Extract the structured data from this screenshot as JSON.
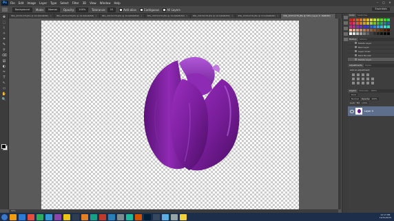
{
  "app": {
    "logo": "Ps"
  },
  "menu": [
    "File",
    "Edit",
    "Image",
    "Layer",
    "Type",
    "Select",
    "Filter",
    "3D",
    "View",
    "Window",
    "Help"
  ],
  "window_controls": [
    "–",
    "▢",
    "✕"
  ],
  "options": {
    "sample": "Background",
    "mode_label": "Mode:",
    "mode_value": "Normal",
    "opacity_label": "Opacity:",
    "opacity_value": "100%",
    "tolerance_label": "Tolerance:",
    "tolerance_value": "10",
    "anti_alias": "Anti-alias",
    "contiguous": "Contiguous",
    "all_layers": "All Layers",
    "workspace": "Essentials"
  },
  "tools": [
    "✥",
    "⬚",
    "⌇",
    "✧",
    "⌗",
    "✎",
    "⚲",
    "⌫",
    "▤",
    "◐",
    "✑",
    "T",
    "↖",
    "▭",
    "✋",
    "🔍"
  ],
  "doc_tabs": [
    {
      "label": "IMG_20151276.JPG @ 19.9(RGB/8#)",
      "active": false
    },
    {
      "label": "IMG_20151276.JPG @ 19.9(RGB/8#)",
      "active": false
    },
    {
      "label": "IMG_20151276.JPG @ 19.9(RGB/8#)",
      "active": false
    },
    {
      "label": "IMG_20151276.JPG @ 19.9(RGB/8#)",
      "active": false
    },
    {
      "label": "IMG_20151276.JPG @ 19.9(RGB/8#)",
      "active": false
    },
    {
      "label": "IMG_20151276.JPG @ 19.9(RGB/8#)",
      "active": false
    },
    {
      "label": "IMG_20151276.JPG @ 50% (Layer 0, RGB/8#)",
      "active": true
    }
  ],
  "status": "50%",
  "swatch_tabs": [
    "Color",
    "Swatches"
  ],
  "swatch_colors": [
    "#e02020",
    "#e03a20",
    "#e05a20",
    "#e07a20",
    "#e09a20",
    "#e0ba20",
    "#e0da20",
    "#c0e020",
    "#90e020",
    "#60e020",
    "#30e020",
    "#20e050",
    "#d02850",
    "#d04060",
    "#d06040",
    "#d08030",
    "#d0a030",
    "#d0c030",
    "#b0d030",
    "#80c030",
    "#50b040",
    "#40a060",
    "#308080",
    "#3060a0",
    "#c03080",
    "#b03090",
    "#9030a0",
    "#7030b0",
    "#5030c0",
    "#3040c0",
    "#3060d0",
    "#3080e0",
    "#30a0e0",
    "#30c0e0",
    "#30e0e0",
    "#30e0b0",
    "#f0c0a0",
    "#e0b090",
    "#d0a080",
    "#c09070",
    "#b08060",
    "#a07050",
    "#906040",
    "#805030",
    "#704020",
    "#603010",
    "#502000",
    "#401000",
    "#ffffff",
    "#e0e0e0",
    "#c0c0c0",
    "#a0a0a0",
    "#808080",
    "#606060",
    "#404040",
    "#303030",
    "#202020",
    "#101010",
    "#080808",
    "#000000"
  ],
  "history_tabs": [
    "History",
    "Actions"
  ],
  "history": [
    {
      "label": "Delete Layer",
      "selected": false
    },
    {
      "label": "New Layer",
      "selected": false
    },
    {
      "label": "Layer Order",
      "selected": false
    },
    {
      "label": "Paint Bucket",
      "selected": false
    },
    {
      "label": "Delete Layer",
      "selected": true
    }
  ],
  "adjust_tabs": [
    "Adjustments",
    "Styles"
  ],
  "adjust_title": "Add an adjustment",
  "layers_tabs": [
    "Layers",
    "Channels",
    "Paths"
  ],
  "layers": {
    "kind": "Kind",
    "blend": "Normal",
    "opacity_label": "Opacity:",
    "opacity": "100%",
    "lock_label": "Lock:",
    "fill_label": "Fill:",
    "fill": "100%",
    "rows": [
      {
        "name": "Layer 0"
      }
    ]
  },
  "taskbar": {
    "apps": [
      "#f39c12",
      "#2b7bd6",
      "#e74c3c",
      "#27ae60",
      "#3498db",
      "#8e44ad",
      "#f1c40f",
      "#2c3e50",
      "#e67e22",
      "#16a085",
      "#c0392b",
      "#2980b9",
      "#7f8c8d",
      "#1abc9c",
      "#d35400",
      "#001e36",
      "#34495e",
      "#5dade2",
      "#95a5a6",
      "#f4d03f"
    ],
    "time": "12:17 PM",
    "date": "12/31/2015"
  }
}
